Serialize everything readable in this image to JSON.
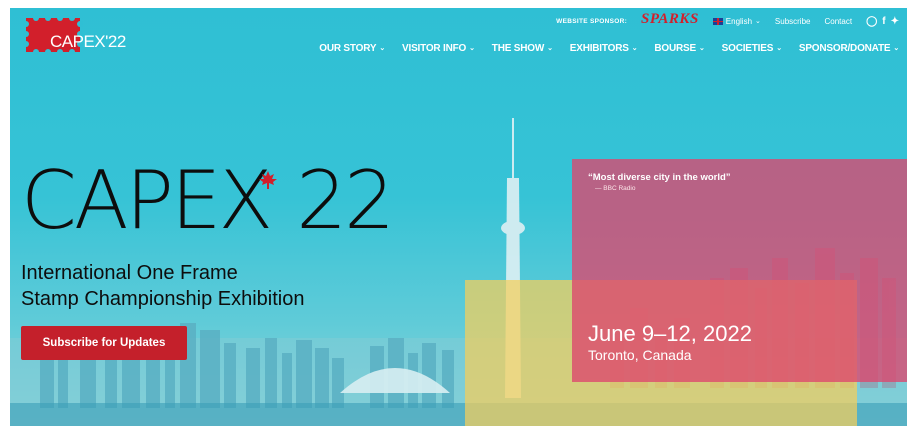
{
  "header": {
    "logo_text": "CAPEX'22",
    "sponsor_label": "WEBSITE SPONSOR:",
    "sponsor_name": "SPARKS",
    "language": "English",
    "subscribe_link": "Subscribe",
    "contact_link": "Contact",
    "social_icons": [
      "instagram-icon",
      "facebook-icon",
      "twitter-icon"
    ]
  },
  "nav": {
    "items": [
      {
        "label": "OUR STORY"
      },
      {
        "label": "VISITOR INFO"
      },
      {
        "label": "THE SHOW"
      },
      {
        "label": "EXHIBITORS"
      },
      {
        "label": "BOURSE"
      },
      {
        "label": "SOCIETIES"
      },
      {
        "label": "SPONSOR/DONATE"
      }
    ]
  },
  "hero": {
    "brand_left": "CAPEX",
    "brand_right": "22",
    "subtitle_line1": "International One Frame",
    "subtitle_line2": "Stamp Championship Exhibition",
    "cta_label": "Subscribe for Updates",
    "quote": "“Most diverse city in the world”",
    "quote_source": "— BBC Radio",
    "date": "June 9–12, 2022",
    "location": "Toronto, Canada"
  },
  "colors": {
    "accent_red": "#c4202b",
    "sky": "#2fbfd4",
    "pink_overlay": "#dc466e",
    "yellow_overlay": "#f5cf5a"
  }
}
